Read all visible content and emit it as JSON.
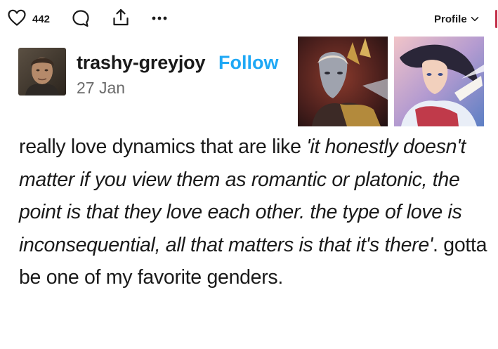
{
  "actions": {
    "like_count": "442",
    "profile_label": "Profile"
  },
  "post": {
    "blog_name": "trashy-greyjoy",
    "follow_label": "Follow",
    "date": "27 Jan",
    "text_lead": "really love dynamics that are like ",
    "text_quote": "'it honestly doesn't matter if you view them as romantic or platonic, the point is that they love each other. the type of love is inconsequential, all that matters is that it's there'",
    "text_tail": ". gotta be one of my favorite genders."
  },
  "colors": {
    "follow": "#1fa8f5",
    "date": "#6b6b6b",
    "text": "#1a1a1a"
  },
  "icons": [
    "heart-icon",
    "reply-icon",
    "share-icon",
    "more-icon",
    "chevron-down-icon"
  ]
}
